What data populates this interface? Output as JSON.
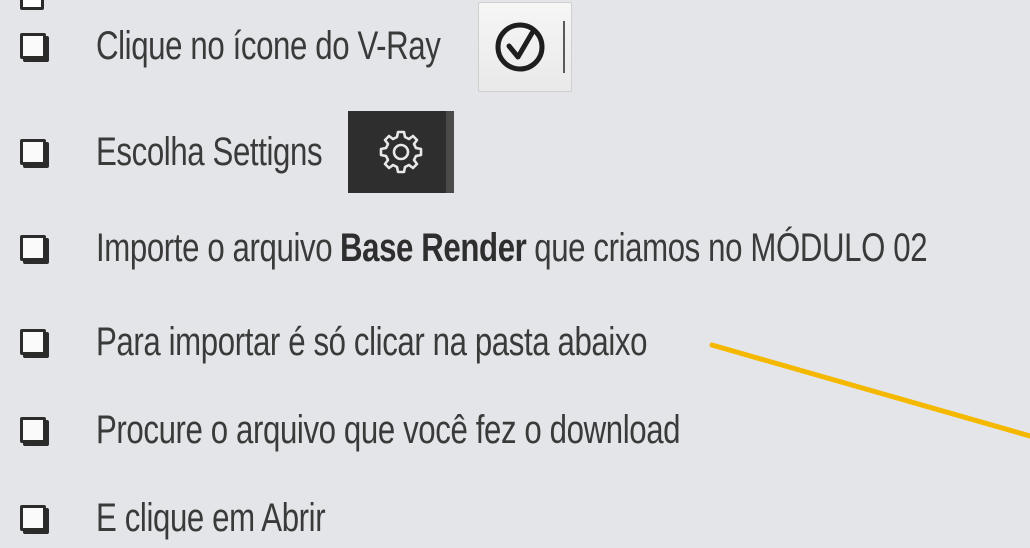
{
  "checklist": [
    {
      "text": "Clique no ícone do V-Ray"
    },
    {
      "text": "Escolha Settigns"
    },
    {
      "text_before": "Importe o arquivo",
      "text_bold": "Base Render",
      "text_after": "que criamos no MÓDULO 02"
    },
    {
      "text": "Para importar é só clicar na pasta abaixo"
    },
    {
      "text": "Procure o arquivo que você fez o download"
    },
    {
      "text": "E clique em Abrir"
    }
  ],
  "icons": {
    "vray": "vray-logo-icon",
    "settings": "gear-icon",
    "checkbox": "checkbox-icon"
  },
  "colors": {
    "background": "#e3e5e8",
    "text": "#3a3a3a",
    "arrow": "#f5b800",
    "settings_button": "#2e2e2e"
  }
}
